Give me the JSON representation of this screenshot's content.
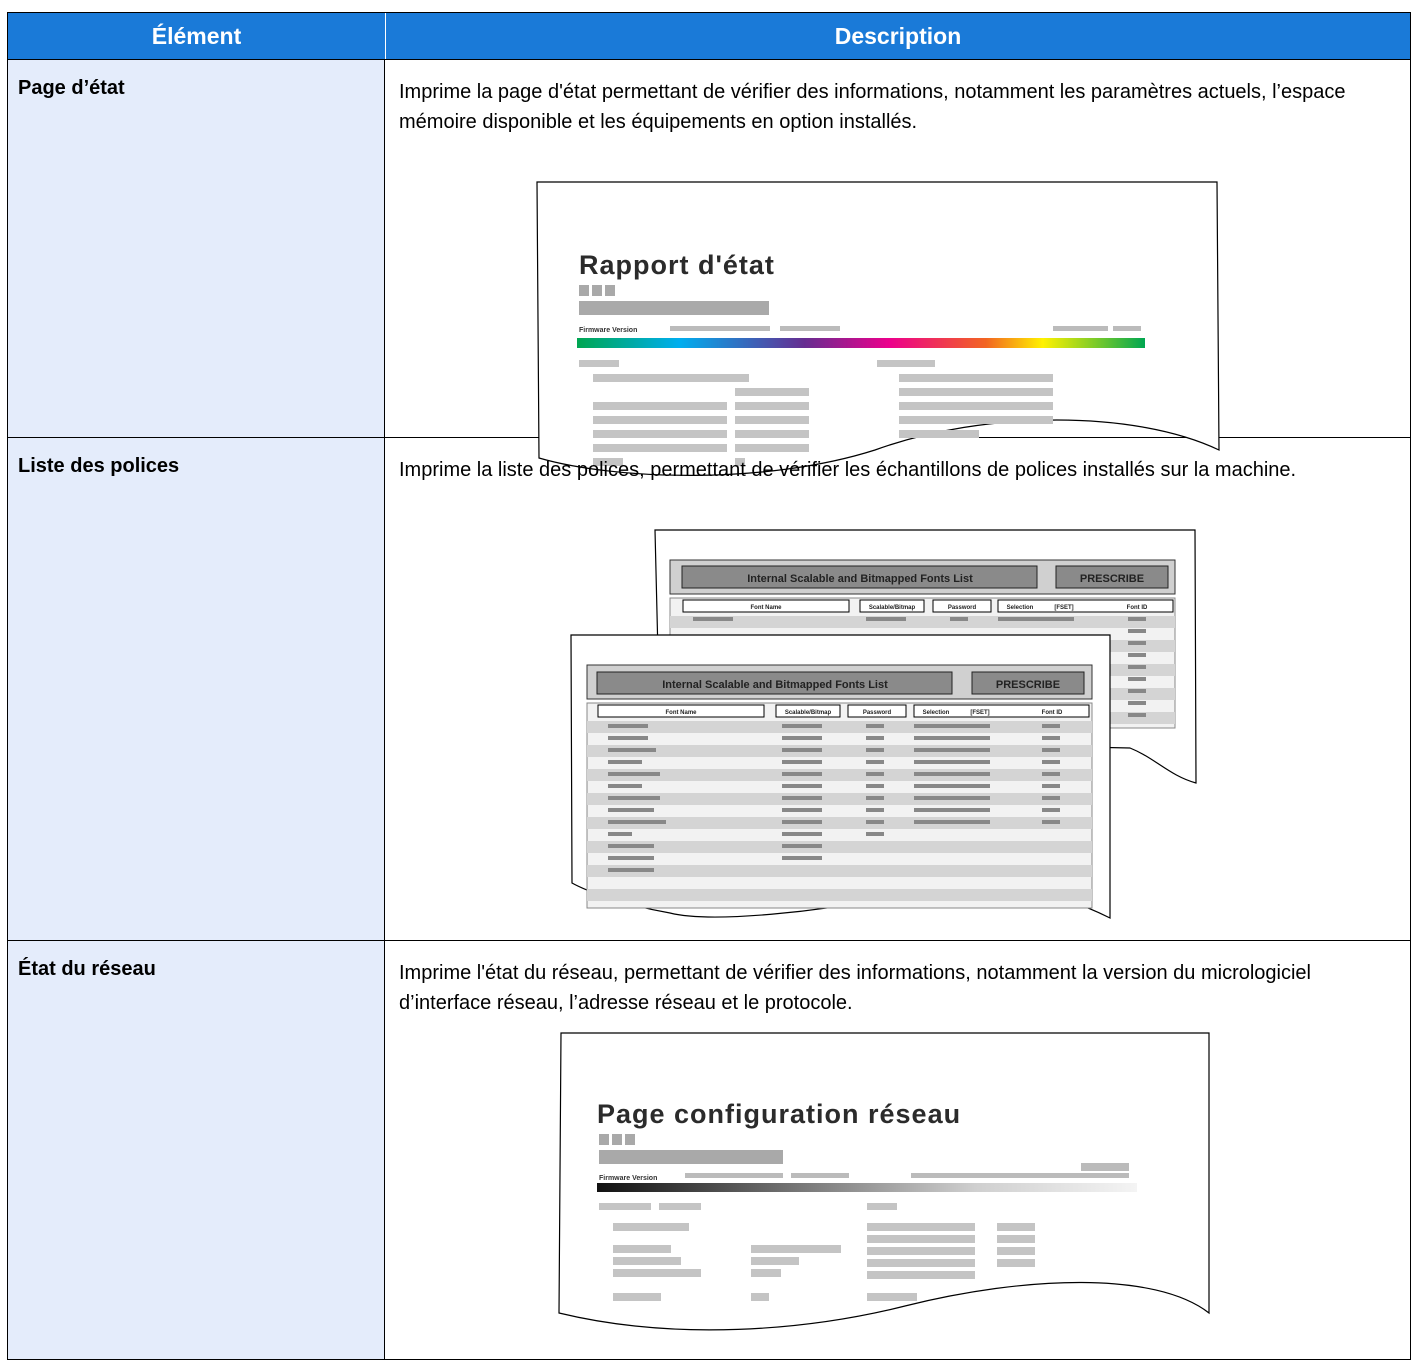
{
  "table": {
    "headers": {
      "element": "Élément",
      "description": "Description"
    },
    "rows": [
      {
        "element": "Page d’état",
        "description": "Imprime la page d'état permettant de vérifier des informations, notamment les paramètres actuels, l’espace mémoire disponible et les équipements en option installés.",
        "illustration": {
          "title": "Rapport d'état",
          "firmware_label": "Firmware Version"
        }
      },
      {
        "element": "Liste des polices",
        "description": "Imprime la liste des polices, permettant de vérifier les échantillons de polices installés sur la machine.",
        "illustration": {
          "banner": "Internal Scalable and Bitmapped Fonts List",
          "badge": "PRESCRIBE",
          "col_font_name": "Font Name",
          "col_scalable": "Scalable/Bitmap",
          "col_password": "Password",
          "col_selection": "Selection",
          "col_fset": "[FSET]",
          "col_font_id": "Font ID"
        }
      },
      {
        "element": "État du réseau",
        "description": "Imprime l'état du réseau, permettant de vérifier des informations, notamment la version du micrologiciel d’interface réseau, l’adresse réseau et le protocole.",
        "illustration": {
          "title": "Page configuration réseau",
          "firmware_label": "Firmware Version"
        }
      }
    ]
  }
}
